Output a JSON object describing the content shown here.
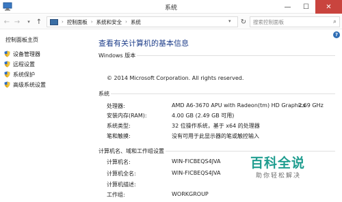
{
  "window": {
    "title": "系统",
    "min_glyph": "—",
    "max_glyph": "☐",
    "close_glyph": "✕"
  },
  "addressbar": {
    "back_glyph": "←",
    "forward_glyph": "→",
    "up_glyph": "↑",
    "crumbs": [
      "控制面板",
      "系统和安全",
      "系统"
    ],
    "separator": "›",
    "search_placeholder": "搜索控制面板"
  },
  "sidebar": {
    "home_label": "控制面板主页",
    "items": [
      {
        "label": "设备管理器",
        "icon": "shield-icon"
      },
      {
        "label": "远程设置",
        "icon": "shield-icon"
      },
      {
        "label": "系统保护",
        "icon": "shield-icon"
      },
      {
        "label": "高级系统设置",
        "icon": "shield-icon"
      }
    ]
  },
  "main": {
    "title": "查看有关计算机的基本信息",
    "help_glyph": "?",
    "windows_edition": {
      "heading": "Windows 版本",
      "copyright": "© 2014 Microsoft Corporation. All rights reserved."
    },
    "system": {
      "heading": "系统",
      "rows": [
        {
          "label": "处理器:",
          "value": "AMD A6-3670 APU with Radeon(tm) HD Graphics",
          "extra": "2.69 GHz"
        },
        {
          "label": "安装内存(RAM):",
          "value": "4.00 GB (2.49 GB 可用)"
        },
        {
          "label": "系统类型:",
          "value": "32 位操作系统，基于 x64 的处理器"
        },
        {
          "label": "笔和触摸:",
          "value": "没有可用于此显示器的笔或触控输入"
        }
      ]
    },
    "computer": {
      "heading": "计算机名、域和工作组设置",
      "rows": [
        {
          "label": "计算机名:",
          "value": "WIN-FICBEQS4JVA"
        },
        {
          "label": "计算机全名:",
          "value": "WIN-FICBEQS4JVA"
        },
        {
          "label": "计算机描述:",
          "value": ""
        },
        {
          "label": "工作组:",
          "value": "WORKGROUP"
        }
      ]
    }
  },
  "watermark": {
    "title": "百科全说",
    "subtitle": "助你轻松解决"
  },
  "colors": {
    "accent": "#1e3e8a",
    "close": "#c9443e",
    "watermark": "#1f9d8f"
  }
}
